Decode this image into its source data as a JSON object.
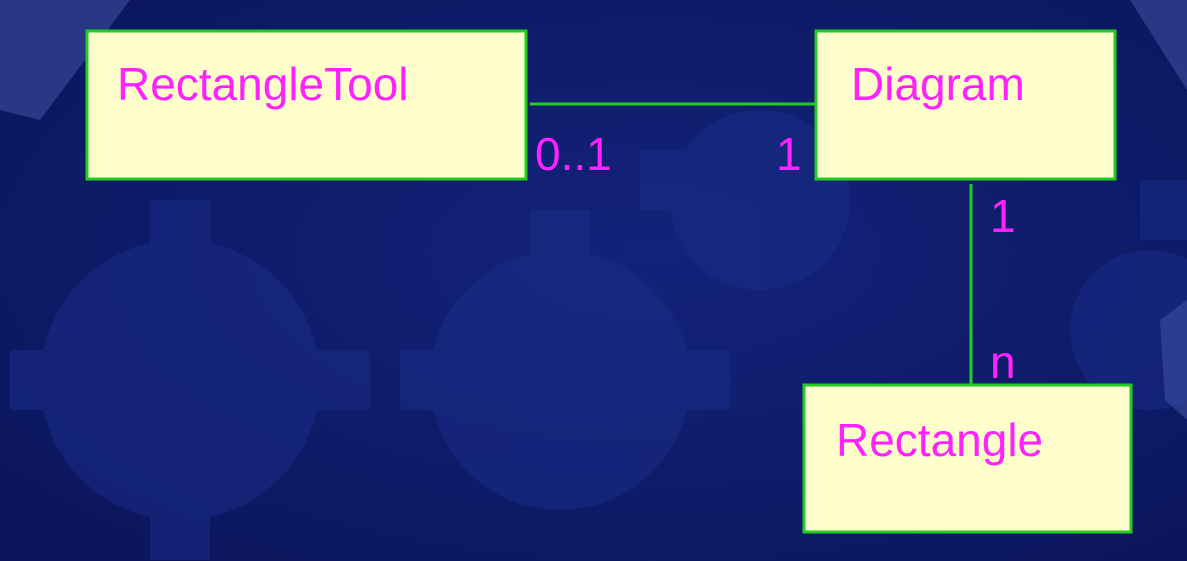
{
  "colors": {
    "background": "#0d1a66",
    "class_fill": "#ffffcc",
    "class_border": "#22cc22",
    "association_line": "#22cc22",
    "text": "#ff22ff"
  },
  "classes": {
    "rectangle_tool": "RectangleTool",
    "diagram": "Diagram",
    "rectangle": "Rectangle"
  },
  "associations": {
    "tool_diagram": {
      "tool_end": "0..1",
      "diagram_end": "1"
    },
    "diagram_rectangle": {
      "diagram_end": "1",
      "rectangle_end": "n"
    }
  }
}
